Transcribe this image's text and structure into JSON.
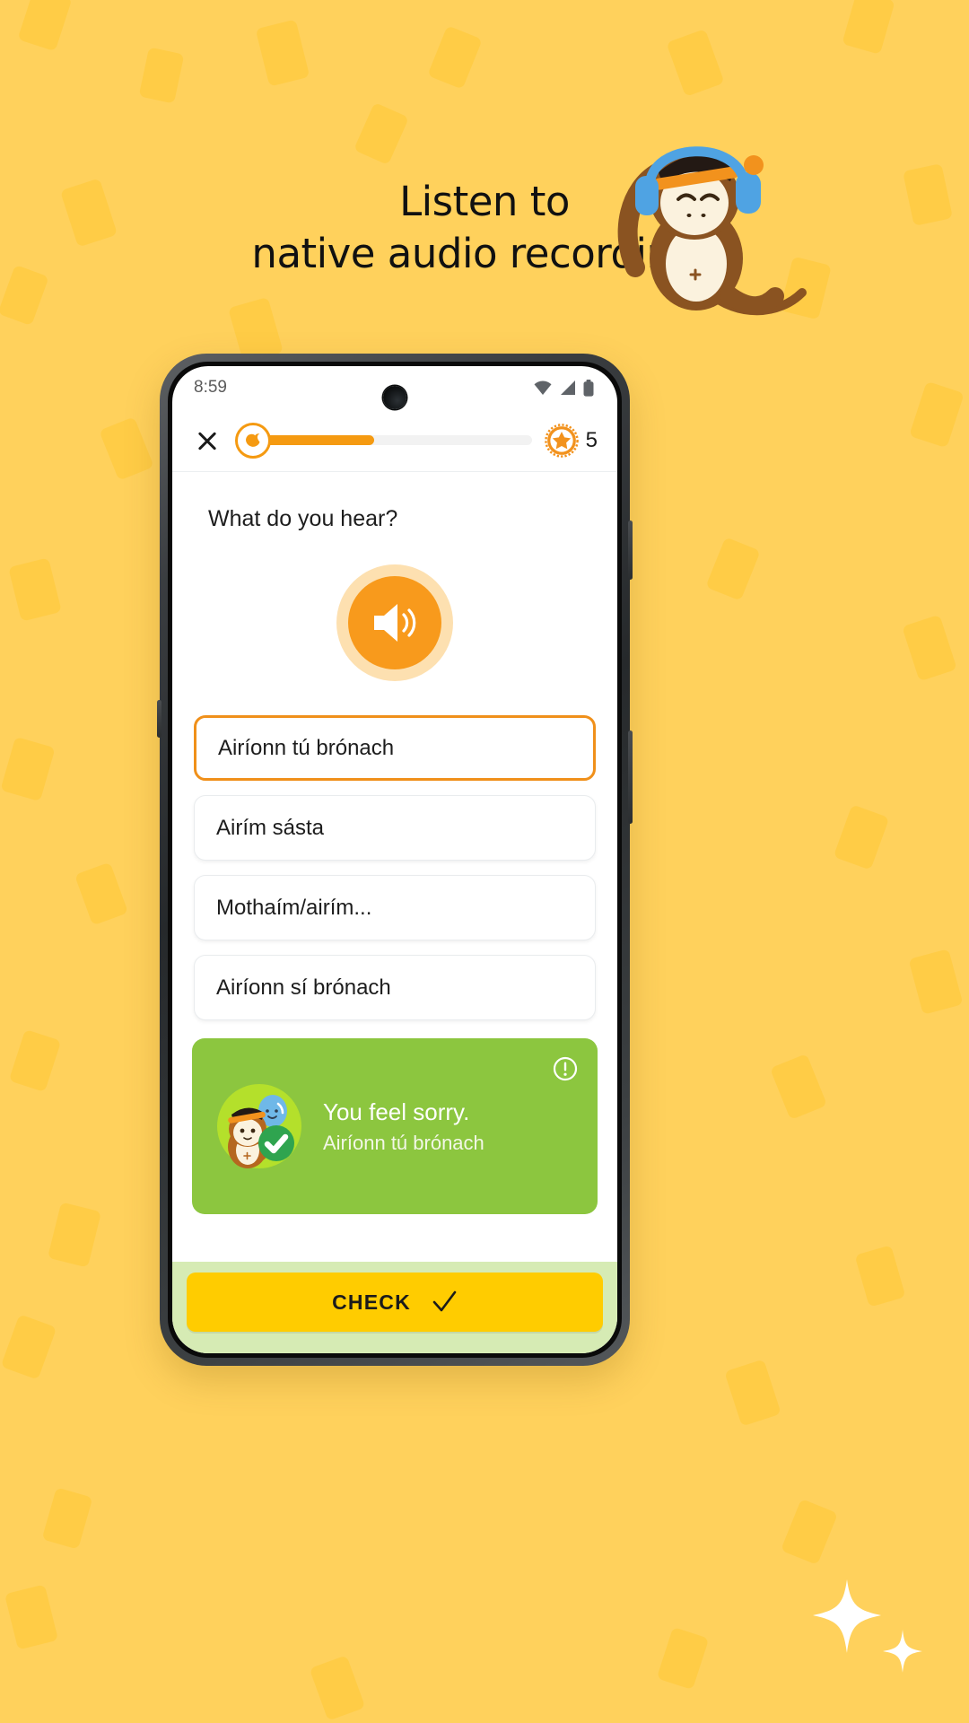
{
  "promo": {
    "background_color": "#FFD15C",
    "confetti_color": "#FFCB42",
    "headline_line1": "Listen to",
    "headline_line2": "native audio recordings",
    "mascot": "monkey-with-headphones"
  },
  "phone": {
    "status_bar": {
      "time": "8:59",
      "icons": [
        "wifi-icon",
        "cell-signal-icon",
        "battery-icon"
      ]
    }
  },
  "lesson": {
    "header": {
      "close_label": "close-icon",
      "progress_percent": 43,
      "progress_color": "#F59A11",
      "badge_icon": "mondly-mascot-icon",
      "coin_icon": "star-coin-icon",
      "coin_count": "5"
    },
    "question": "What do you hear?",
    "audio_button": {
      "icon": "speaker-icon",
      "color": "#F89A1C",
      "halo_color": "#FDE0B0"
    },
    "options": [
      {
        "label": "Airíonn tú brónach",
        "selected": true
      },
      {
        "label": "Airím sásta",
        "selected": false
      },
      {
        "label": "Mothaím/airím...",
        "selected": false
      },
      {
        "label": "Airíonn sí brónach",
        "selected": false
      }
    ],
    "feedback": {
      "background_color": "#8CC63F",
      "avatar_icon": "monkey-with-balloon-icon",
      "status_icon": "check-circle-icon",
      "info_icon": "info-exclamation-icon",
      "title": "You feel sorry.",
      "subtitle": "Airíonn tú brónach"
    },
    "footer": {
      "bar_color": "#D6EBB4",
      "check_label": "CHECK",
      "check_icon": "checkmark-icon",
      "check_color": "#FFCC00"
    }
  }
}
